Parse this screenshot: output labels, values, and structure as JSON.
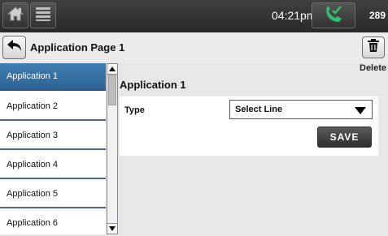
{
  "topbar": {
    "time": "04:21pm",
    "count": "289",
    "icons": [
      "home-icon",
      "menu-icon",
      "phone-check-icon"
    ]
  },
  "header": {
    "title": "Application Page 1",
    "delete_label": "Delete",
    "icons": [
      "back-arrow-icon",
      "trash-icon"
    ]
  },
  "sidebar": {
    "items": [
      {
        "label": "Application 1",
        "active": true
      },
      {
        "label": "Application 2",
        "active": false
      },
      {
        "label": "Application 3",
        "active": false
      },
      {
        "label": "Application 4",
        "active": false
      },
      {
        "label": "Application 5",
        "active": false
      },
      {
        "label": "Application 6",
        "active": false
      }
    ]
  },
  "main": {
    "title": "Application 1",
    "type_label": "Type",
    "type_value": "Select Line",
    "save_label": "SAVE"
  },
  "colors": {
    "accent": "#3e7cb1",
    "topbar": "#2f2f2f",
    "phone": "#2fbf71"
  }
}
